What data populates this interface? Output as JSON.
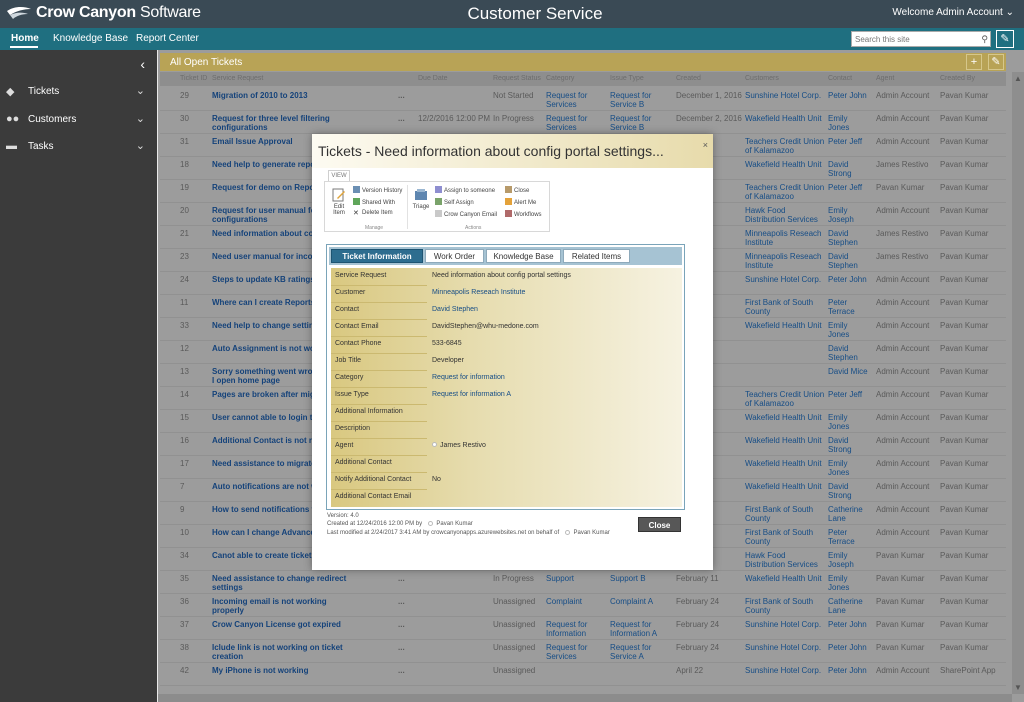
{
  "app": {
    "logo_brand": "Crow Canyon",
    "logo_rest": " Software",
    "title": "Customer Service",
    "welcome": "Welcome Admin Account",
    "welcome_chevron": "⌄",
    "search_placeholder": "Search this site"
  },
  "nav": [
    {
      "label": "Home",
      "active": true
    },
    {
      "label": "Knowledge Base"
    },
    {
      "label": "Report Center"
    }
  ],
  "sidebar": {
    "items": [
      {
        "label": "Tickets",
        "icon": "tag-icon"
      },
      {
        "label": "Customers",
        "icon": "people-icon"
      },
      {
        "label": "Tasks",
        "icon": "tasks-icon"
      }
    ]
  },
  "main": {
    "title": "All Open Tickets",
    "add": "+",
    "edit": "✎",
    "columns": [
      "Ticket ID",
      "Service Request",
      "Due Date",
      "Request Status",
      "Category",
      "Issue Type",
      "Created",
      "Customers",
      "Contact",
      "Agent",
      "Created By"
    ],
    "rows": [
      {
        "id": "29",
        "title": "Migration of 2010 to 2013",
        "dots": "...",
        "due": "",
        "status": "Not Started",
        "cat": "Request for Services",
        "itype": "Request for Service B",
        "created": "December 1, 2016",
        "cust": "Sunshine Hotel Corp.",
        "contact": "Peter John",
        "agent": "Admin Account",
        "cby": "Pavan Kumar"
      },
      {
        "id": "30",
        "title": "Request for three level filtering configurations",
        "dots": "...",
        "due": "12/2/2016 12:00 PM",
        "status": "In Progress",
        "cat": "Request for Services",
        "itype": "Request for Service B",
        "created": "December 2, 2016",
        "cust": "Wakefield Health Unit",
        "contact": "Emily Jones",
        "agent": "Admin Account",
        "cby": "Pavan Kumar"
      },
      {
        "id": "31",
        "title": "Email Issue Approval",
        "dots": "",
        "due": "",
        "status": "",
        "cat": "",
        "itype": "",
        "created": "",
        "cust": "Teachers Credit Union of Kalamazoo",
        "contact": "Peter Jeff",
        "agent": "Admin Account",
        "cby": "Pavan Kumar"
      },
      {
        "id": "18",
        "title": "Need help to generate report Date",
        "dots": "",
        "due": "",
        "status": "",
        "cat": "",
        "itype": "",
        "created": "",
        "cust": "Wakefield Health Unit",
        "contact": "David Strong",
        "agent": "James Restivo",
        "cby": "Pavan Kumar"
      },
      {
        "id": "19",
        "title": "Request for demo on Report",
        "dots": "",
        "due": "",
        "status": "",
        "cat": "",
        "itype": "",
        "created": "",
        "cust": "Teachers Credit Union of Kalamazoo",
        "contact": "Peter Jeff",
        "agent": "Pavan Kumar",
        "cby": "Pavan Kumar"
      },
      {
        "id": "20",
        "title": "Request for user manual for configurations",
        "dots": "",
        "due": "",
        "status": "",
        "cat": "",
        "itype": "",
        "created": "",
        "cust": "Hawk Food Distribution Services",
        "contact": "Emily Joseph",
        "agent": "Admin Account",
        "cby": "Pavan Kumar"
      },
      {
        "id": "21",
        "title": "Need information about con",
        "dots": "",
        "due": "",
        "status": "",
        "cat": "",
        "itype": "",
        "created": "",
        "cust": "Minneapolis Reseach Institute",
        "contact": "David Stephen",
        "agent": "James Restivo",
        "cby": "Pavan Kumar"
      },
      {
        "id": "23",
        "title": "Need user manual for incom",
        "dots": "",
        "due": "",
        "status": "",
        "cat": "",
        "itype": "",
        "created": "",
        "cust": "Minneapolis Reseach Institute",
        "contact": "David Stephen",
        "agent": "James Restivo",
        "cby": "Pavan Kumar"
      },
      {
        "id": "24",
        "title": "Steps to update KB ratings",
        "dots": "",
        "due": "",
        "status": "",
        "cat": "",
        "itype": "",
        "created": "",
        "cust": "Sunshine Hotel Corp.",
        "contact": "Peter John",
        "agent": "Admin Account",
        "cby": "Pavan Kumar"
      },
      {
        "id": "11",
        "title": "Where can I create Reports?",
        "dots": "",
        "due": "",
        "status": "",
        "cat": "",
        "itype": "",
        "created": "",
        "cust": "First Bank of South County",
        "contact": "Peter Terrace",
        "agent": "Admin Account",
        "cby": "Pavan Kumar"
      },
      {
        "id": "33",
        "title": "Need help to change setting",
        "dots": "",
        "due": "",
        "status": "",
        "cat": "",
        "itype": "",
        "created": "",
        "cust": "Wakefield Health Unit",
        "contact": "Emily Jones",
        "agent": "Admin Account",
        "cby": "Pavan Kumar"
      },
      {
        "id": "12",
        "title": "Auto Assignment is not work",
        "dots": "",
        "due": "",
        "status": "",
        "cat": "",
        "itype": "",
        "created": "",
        "cust": "",
        "contact": "David Stephen",
        "agent": "Admin Account",
        "cby": "Pavan Kumar"
      },
      {
        "id": "13",
        "title": "Sorry something went wrong when I open home page",
        "dots": "",
        "due": "",
        "status": "",
        "cat": "",
        "itype": "",
        "created": "",
        "cust": "",
        "contact": "David Mice",
        "agent": "Admin Account",
        "cby": "Pavan Kumar"
      },
      {
        "id": "14",
        "title": "Pages are broken after migra",
        "dots": "",
        "due": "",
        "status": "",
        "cat": "",
        "itype": "",
        "created": "",
        "cust": "Teachers Credit Union of Kalamazoo",
        "contact": "Peter Jeff",
        "agent": "Admin Account",
        "cby": "Pavan Kumar"
      },
      {
        "id": "15",
        "title": "User cannot able to login to",
        "dots": "",
        "due": "",
        "status": "",
        "cat": "",
        "itype": "",
        "created": "",
        "cust": "Wakefield Health Unit",
        "contact": "Emily Jones",
        "agent": "Admin Account",
        "cby": "Pavan Kumar"
      },
      {
        "id": "16",
        "title": "Additional Contact is not rec",
        "dots": "",
        "due": "",
        "status": "",
        "cat": "",
        "itype": "",
        "created": "",
        "cust": "Wakefield Health Unit",
        "contact": "David Strong",
        "agent": "Admin Account",
        "cby": "Pavan Kumar"
      },
      {
        "id": "17",
        "title": "Need assistance to migrate fr",
        "dots": "",
        "due": "",
        "status": "",
        "cat": "",
        "itype": "",
        "created": "",
        "cust": "Wakefield Health Unit",
        "contact": "Emily Jones",
        "agent": "Admin Account",
        "cby": "Pavan Kumar"
      },
      {
        "id": "7",
        "title": "Auto notifications are not wo",
        "dots": "",
        "due": "",
        "status": "",
        "cat": "",
        "itype": "",
        "created": "",
        "cust": "Wakefield Health Unit",
        "contact": "David Strong",
        "agent": "Admin Account",
        "cby": "Pavan Kumar"
      },
      {
        "id": "9",
        "title": "How to send notifications to",
        "dots": "",
        "due": "",
        "status": "",
        "cat": "",
        "itype": "",
        "created": "",
        "cust": "First Bank of South County",
        "contact": "Catherine Lane",
        "agent": "Admin Account",
        "cby": "Pavan Kumar"
      },
      {
        "id": "10",
        "title": "How can I change Advanced",
        "dots": "",
        "due": "",
        "status": "",
        "cat": "",
        "itype": "",
        "created": "",
        "cust": "First Bank of South County",
        "contact": "Peter Terrace",
        "agent": "Admin Account",
        "cby": "Pavan Kumar"
      },
      {
        "id": "34",
        "title": "Canot able to create tickets n",
        "dots": "",
        "due": "",
        "status": "",
        "cat": "",
        "itype": "",
        "created": "",
        "cust": "Hawk Food Distribution Services",
        "contact": "Emily Joseph",
        "agent": "Pavan Kumar",
        "cby": "Pavan Kumar"
      },
      {
        "id": "35",
        "title": "Need assistance to change redirect settings",
        "dots": "...",
        "due": "",
        "status": "In Progress",
        "cat": "Support",
        "itype": "Support B",
        "created": "February 11",
        "cust": "Wakefield Health Unit",
        "contact": "Emily Jones",
        "agent": "Pavan Kumar",
        "cby": "Pavan Kumar"
      },
      {
        "id": "36",
        "title": "Incoming email is not working properly",
        "dots": "...",
        "due": "",
        "status": "Unassigned",
        "cat": "Complaint",
        "itype": "Complaint A",
        "created": "February 24",
        "cust": "First Bank of South County",
        "contact": "Catherine Lane",
        "agent": "Pavan Kumar",
        "cby": "Pavan Kumar"
      },
      {
        "id": "37",
        "title": "Crow Canyon License got expired",
        "dots": "...",
        "due": "",
        "status": "Unassigned",
        "cat": "Request for Information",
        "itype": "Request for Information A",
        "created": "February 24",
        "cust": "Sunshine Hotel Corp.",
        "contact": "Peter John",
        "agent": "Pavan Kumar",
        "cby": "Pavan Kumar"
      },
      {
        "id": "38",
        "title": "Iclude link is not working on ticket creation",
        "dots": "...",
        "due": "",
        "status": "Unassigned",
        "cat": "Request for Services",
        "itype": "Request for Service A",
        "created": "February 24",
        "cust": "Sunshine Hotel Corp.",
        "contact": "Peter John",
        "agent": "Pavan Kumar",
        "cby": "Pavan Kumar"
      },
      {
        "id": "42",
        "title": "My iPhone is not working",
        "dots": "...",
        "due": "",
        "status": "Unassigned",
        "cat": "",
        "itype": "",
        "created": "April 22",
        "cust": "Sunshine Hotel Corp.",
        "contact": "Peter John",
        "agent": "Admin Account",
        "cby": "SharePoint App"
      }
    ]
  },
  "modal": {
    "title": "Tickets - Need information about config portal settings...",
    "close": "×",
    "ribbon_tab": "VIEW",
    "ribbon": {
      "edit_item": "Edit Item",
      "version_history": "Version History",
      "shared_with": "Shared With",
      "delete_item": "Delete Item",
      "group_manage": "Manage",
      "triage": "Triage",
      "assign_to_someone": "Assign to someone",
      "self_assign": "Self Assign",
      "crow_canyon_email": "Crow Canyon Email",
      "close": "Close",
      "alert_me": "Alert Me",
      "workflows": "Workflows",
      "group_actions": "Actions"
    },
    "tabs": [
      "Ticket Information",
      "Work Order",
      "Knowledge Base",
      "Related Items"
    ],
    "fields": [
      {
        "label": "Service Request",
        "value": "Need information about config portal settings",
        "link": false
      },
      {
        "label": "Customer",
        "value": "Minneapolis Reseach Institute",
        "link": true
      },
      {
        "label": "Contact",
        "value": "David Stephen",
        "link": true
      },
      {
        "label": "Contact Email",
        "value": "DavidStephen@whu-medone.com",
        "link": false
      },
      {
        "label": "Contact Phone",
        "value": "533-6845",
        "link": false
      },
      {
        "label": "Job Title",
        "value": "Developer",
        "link": false
      },
      {
        "label": "Category",
        "value": "Request for information",
        "link": true
      },
      {
        "label": "Issue Type",
        "value": "Request for information A",
        "link": true
      },
      {
        "label": "Additional Information",
        "value": "",
        "link": false
      },
      {
        "label": "Description",
        "value": "",
        "link": false
      },
      {
        "label": "Agent",
        "value": "James Restivo",
        "link": false
      },
      {
        "label": "Additional Contact",
        "value": "",
        "link": false
      },
      {
        "label": "Notify Additional Contact",
        "value": "No",
        "link": false
      },
      {
        "label": "Additional Contact Email",
        "value": "",
        "link": false
      }
    ],
    "version": "Version: 4.0",
    "created_text": "Created at 12/24/2016 12:00 PM by",
    "created_by": "Pavan Kumar",
    "modified_text": "Last modified at 2/24/2017 3:41 AM by crowcanyonapps.azurewebsites.net on behalf of",
    "modified_by": "Pavan Kumar",
    "close_button": "Close"
  },
  "colors": {
    "header": "#3a4a55",
    "nav": "#1f6f80",
    "sidebar": "#3b3b3b",
    "accent_gold": "#b8a356",
    "tab_active": "#2d6d8f"
  }
}
